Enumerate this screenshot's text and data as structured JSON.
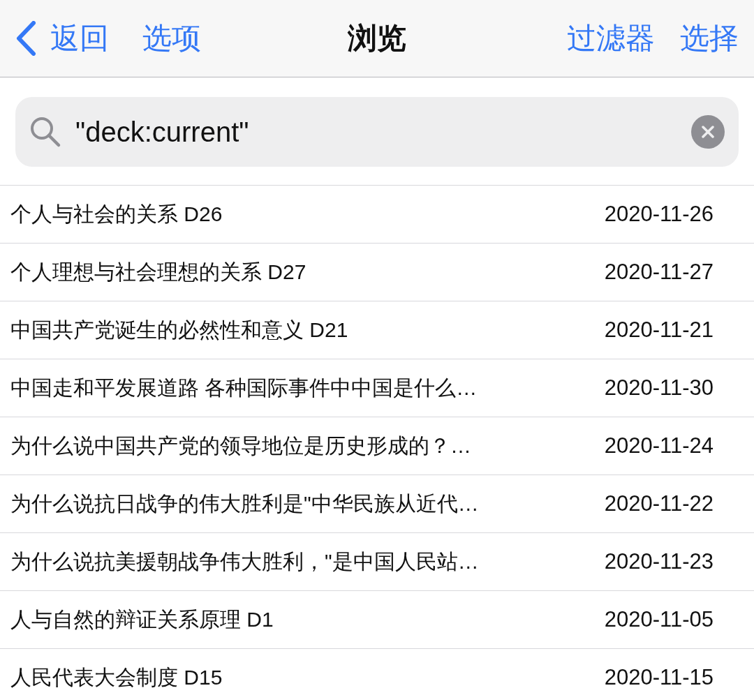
{
  "nav": {
    "back": "返回",
    "options": "选项",
    "title": "浏览",
    "filter": "过滤器",
    "select": "选择"
  },
  "search": {
    "value": "\"deck:current\""
  },
  "rows": [
    {
      "title": "个人与社会的关系 D26",
      "date": "2020-11-26"
    },
    {
      "title": "个人理想与社会理想的关系 D27",
      "date": "2020-11-27"
    },
    {
      "title": "中国共产党诞生的必然性和意义 D21",
      "date": "2020-11-21"
    },
    {
      "title": "中国走和平发展道路 各种国际事件中中国是什么…",
      "date": "2020-11-30"
    },
    {
      "title": "为什么说中国共产党的领导地位是历史形成的？…",
      "date": "2020-11-24"
    },
    {
      "title": "为什么说抗日战争的伟大胜利是\"中华民族从近代…",
      "date": "2020-11-22"
    },
    {
      "title": "为什么说抗美援朝战争伟大胜利，\"是中国人民站…",
      "date": "2020-11-23"
    },
    {
      "title": "人与自然的辩证关系原理 D1",
      "date": "2020-11-05"
    },
    {
      "title": "人民代表大会制度 D15",
      "date": "2020-11-15"
    }
  ]
}
